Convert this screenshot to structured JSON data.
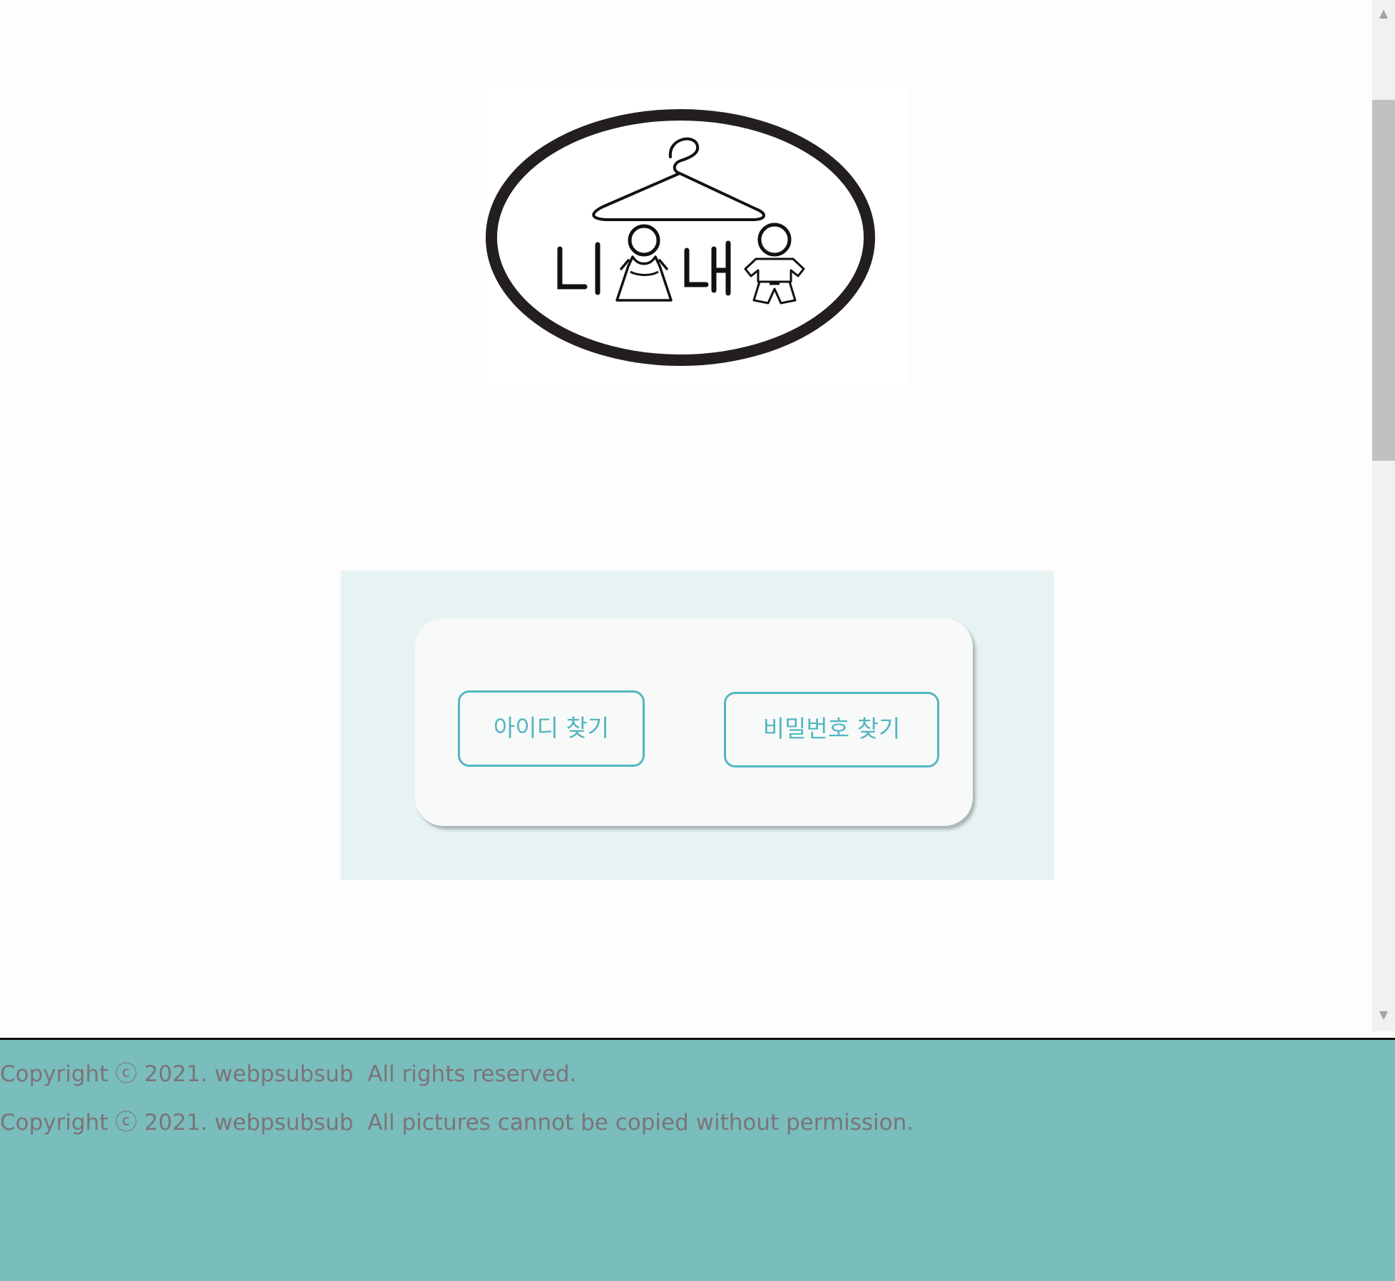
{
  "logo": {
    "text": "니옷내옷",
    "icon": "hanger-couple-logo"
  },
  "find": {
    "id_button_label": "아이디 찾기",
    "password_button_label": "비밀번호 찾기"
  },
  "footer": {
    "line1": "Copyright ⓒ 2021. webpsubsub  All rights reserved.",
    "line2": "Copyright ⓒ 2021. webpsubsub  All pictures cannot be copied without permission."
  },
  "colors": {
    "accent": "#52b7c1",
    "panel_bg": "#e7f3f3",
    "card_bg": "#f8faf9",
    "footer_bg": "#7abdbd",
    "footer_text": "#7c7477"
  }
}
